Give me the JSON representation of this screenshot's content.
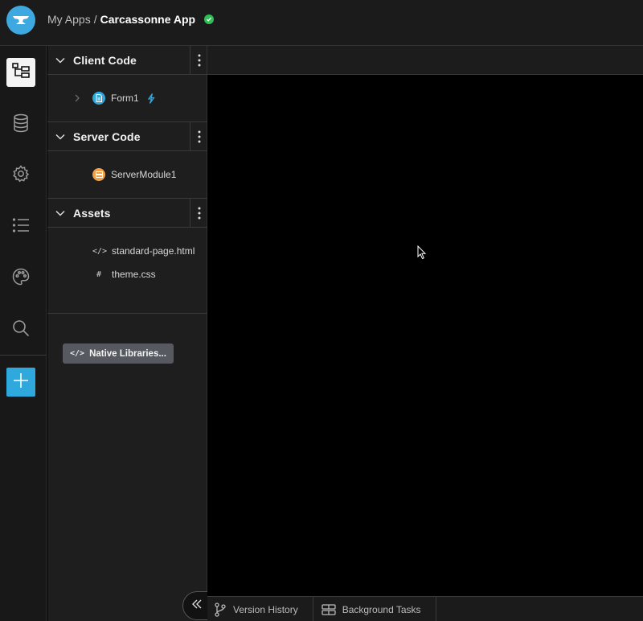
{
  "header": {
    "breadcrumb_root": "My Apps",
    "breadcrumb_sep": "/",
    "app_name": "Carcassonne App",
    "status": "saved"
  },
  "rail": {
    "items": [
      {
        "icon": "app-tree-icon",
        "active": true
      },
      {
        "icon": "database-icon"
      },
      {
        "icon": "gear-icon"
      },
      {
        "icon": "list-icon"
      },
      {
        "icon": "palette-icon"
      },
      {
        "icon": "search-icon"
      }
    ],
    "add_icon": "plus-icon"
  },
  "panel": {
    "client": {
      "title": "Client Code",
      "items": [
        {
          "label": "Form1",
          "icon": "form-icon",
          "badge_icon": "lightning-icon"
        }
      ]
    },
    "server": {
      "title": "Server Code",
      "items": [
        {
          "label": "ServerModule1",
          "icon": "server-module-icon"
        }
      ]
    },
    "assets": {
      "title": "Assets",
      "items": [
        {
          "label": "standard-page.html",
          "icon": "code-icon",
          "glyph": "</>"
        },
        {
          "label": "theme.css",
          "icon": "hash-icon",
          "glyph": "#"
        }
      ]
    },
    "native_libraries": "Native Libraries..."
  },
  "bottombar": {
    "version_history": "Version History",
    "background_tasks": "Background Tasks"
  },
  "colors": {
    "accent": "#2fa8de",
    "success": "#2fbf57",
    "server_module": "#f0a04b"
  }
}
